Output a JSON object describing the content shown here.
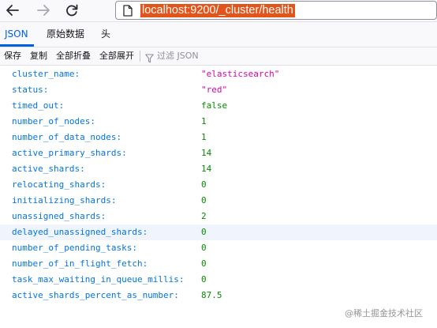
{
  "browser": {
    "url": "localhost:9200/_cluster/health"
  },
  "tabs": [
    {
      "label": "JSON"
    },
    {
      "label": "原始数据"
    },
    {
      "label": "头"
    }
  ],
  "toolbar": {
    "save_label": "保存",
    "copy_label": "复制",
    "collapse_all_label": "全部折叠",
    "expand_all_label": "全部展开",
    "filter_placeholder": "过滤 JSON"
  },
  "json_rows": [
    {
      "key": "cluster_name:",
      "value": "\"elasticsearch\"",
      "type": "string"
    },
    {
      "key": "status:",
      "value": "\"red\"",
      "type": "string"
    },
    {
      "key": "timed_out:",
      "value": "false",
      "type": "boolean"
    },
    {
      "key": "number_of_nodes:",
      "value": "1",
      "type": "number"
    },
    {
      "key": "number_of_data_nodes:",
      "value": "1",
      "type": "number"
    },
    {
      "key": "active_primary_shards:",
      "value": "14",
      "type": "number"
    },
    {
      "key": "active_shards:",
      "value": "14",
      "type": "number"
    },
    {
      "key": "relocating_shards:",
      "value": "0",
      "type": "number"
    },
    {
      "key": "initializing_shards:",
      "value": "0",
      "type": "number"
    },
    {
      "key": "unassigned_shards:",
      "value": "2",
      "type": "number"
    },
    {
      "key": "delayed_unassigned_shards:",
      "value": "0",
      "type": "number"
    },
    {
      "key": "number_of_pending_tasks:",
      "value": "0",
      "type": "number"
    },
    {
      "key": "number_of_in_flight_fetch:",
      "value": "0",
      "type": "number"
    },
    {
      "key": "task_max_waiting_in_queue_millis:",
      "value": "0",
      "type": "number"
    },
    {
      "key": "active_shards_percent_as_number:",
      "value": "87.5",
      "type": "number"
    }
  ],
  "watermark": "@稀土掘金技术社区",
  "icons": {
    "back": "back-arrow-icon",
    "forward": "forward-arrow-icon",
    "reload": "reload-icon",
    "page": "page-icon",
    "filter": "filter-icon"
  },
  "colors": {
    "accent": "#0061e0",
    "url_highlight": "#e2541a",
    "json_key": "#0074e8",
    "json_string": "#dd00a9",
    "json_number": "#058b00"
  }
}
